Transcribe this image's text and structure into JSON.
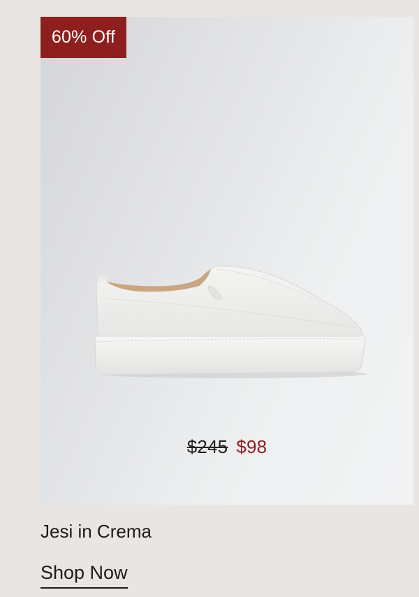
{
  "badge": {
    "label": "60% Off"
  },
  "price": {
    "original": "$245",
    "sale": "$98"
  },
  "product": {
    "name": "Jesi in Crema"
  },
  "cta": {
    "label": "Shop Now"
  },
  "colors": {
    "background": "#e9e5e2",
    "badge": "#8e1f1f",
    "sale_price": "#931d1d",
    "text": "#1b1b1b"
  },
  "icons": {
    "product_image": "white-slip-on-sneaker"
  }
}
